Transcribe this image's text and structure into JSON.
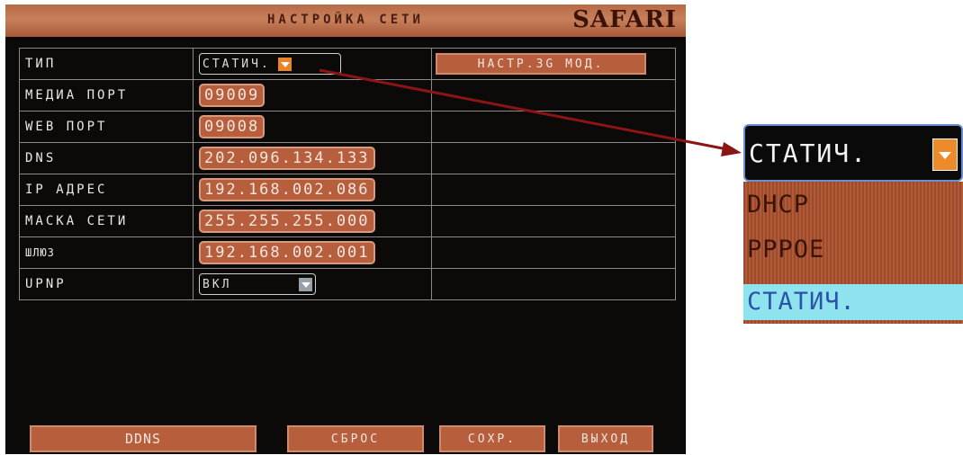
{
  "window": {
    "title": "НАСТРОЙКА СЕТИ",
    "brand": "SAFARI"
  },
  "rows": [
    {
      "label": "ТИП",
      "value": "СТАТИЧ."
    },
    {
      "label": "МЕДИА ПОРТ",
      "value": "09009"
    },
    {
      "label": "WEB ПОРТ",
      "value": "09008"
    },
    {
      "label": "DNS",
      "value": "202.096.134.133"
    },
    {
      "label": "IP АДРЕС",
      "value": "192.168.002.086"
    },
    {
      "label": "МАСКА СЕТИ",
      "value": "255.255.255.000"
    },
    {
      "label": "ШЛЮЗ",
      "value": "192.168.002.001"
    },
    {
      "label": "UPNP",
      "value": "ВКЛ"
    }
  ],
  "buttons": {
    "setup_3g": "НАСТР.3G МОД.",
    "ddns": "DDNS",
    "reset": "СБРОС",
    "save": "СОХР.",
    "exit": "ВЫХОД"
  },
  "zoom": {
    "selected": "СТАТИЧ.",
    "options": [
      "DHCP",
      "PPPOE",
      "СТАТИЧ."
    ]
  },
  "colors": {
    "accent": "#b75e3d",
    "background": "#0c0a09",
    "highlight": "#8fe3ee",
    "arrow": "#8b1414"
  }
}
